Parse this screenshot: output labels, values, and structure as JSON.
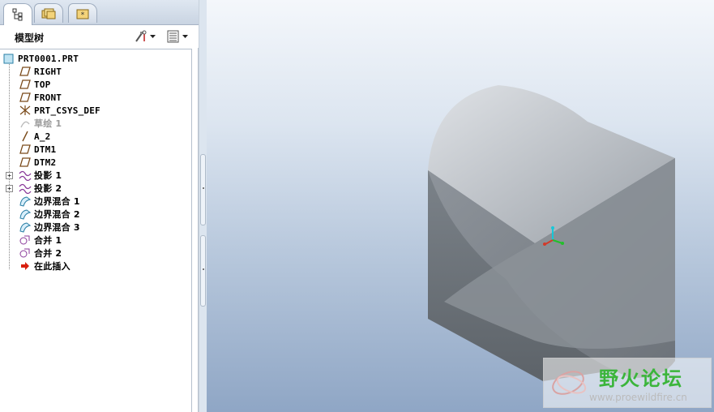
{
  "tabs": [
    {
      "icon": "model-tree-icon"
    },
    {
      "icon": "folder-browser-icon"
    },
    {
      "icon": "favorites-folder-icon"
    }
  ],
  "panel_title": "模型树",
  "tree": {
    "root": "PRT0001.PRT",
    "items": [
      {
        "label": "RIGHT",
        "icon": "datum-plane-icon"
      },
      {
        "label": "TOP",
        "icon": "datum-plane-icon"
      },
      {
        "label": "FRONT",
        "icon": "datum-plane-icon"
      },
      {
        "label": "PRT_CSYS_DEF",
        "icon": "coordinate-system-icon"
      },
      {
        "label": "草绘 1",
        "icon": "sketch-icon",
        "dim": true
      },
      {
        "label": "A_2",
        "icon": "datum-axis-icon"
      },
      {
        "label": "DTM1",
        "icon": "datum-plane-icon"
      },
      {
        "label": "DTM2",
        "icon": "datum-plane-icon"
      },
      {
        "label": "投影 1",
        "icon": "projected-curve-icon",
        "expandable": true
      },
      {
        "label": "投影 2",
        "icon": "projected-curve-icon",
        "expandable": true
      },
      {
        "label": "边界混合 1",
        "icon": "boundary-blend-icon"
      },
      {
        "label": "边界混合 2",
        "icon": "boundary-blend-icon"
      },
      {
        "label": "边界混合 3",
        "icon": "boundary-blend-icon"
      },
      {
        "label": "合并 1",
        "icon": "merge-icon"
      },
      {
        "label": "合并 2",
        "icon": "merge-icon"
      },
      {
        "label": "在此插入",
        "icon": "insert-here-arrow-icon"
      }
    ]
  },
  "watermark": {
    "title": "野火论坛",
    "url": "www.proewildfire.cn"
  },
  "colors": {
    "accent": "#3bb53b",
    "viewport_top": "#f4f7fb",
    "viewport_bottom": "#8fa6c5"
  }
}
